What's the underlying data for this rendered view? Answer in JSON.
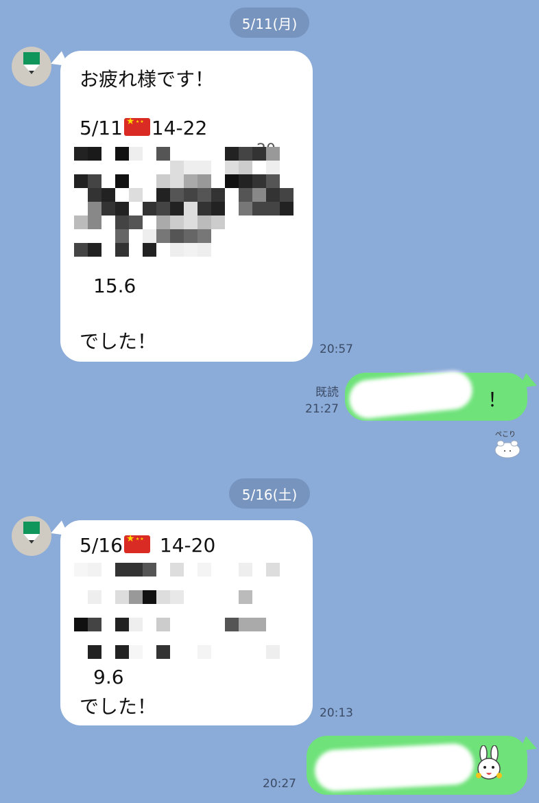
{
  "dates": [
    "5/11(月)",
    "5/16(土)"
  ],
  "messages": {
    "m1": {
      "greeting": "お疲れ様です！",
      "date": "5/11",
      "hours": "14-22",
      "partial_hidden": "20",
      "value": "15.6",
      "closing": "でした！",
      "time": "20:57"
    },
    "reply1": {
      "read_label": "既読",
      "time": "21:27",
      "visible_tail": "！"
    },
    "sticker1": {
      "caption": "ぺこり",
      "icon": "bowing-bunny-sticker"
    },
    "m2": {
      "date": "5/16",
      "hours": "14-20",
      "value": "9.6",
      "closing": "でした！",
      "time": "20:13"
    },
    "reply2": {
      "time": "20:27",
      "icon": "cony-rabbit-emoji"
    }
  },
  "colors": {
    "background": "#8babd8",
    "incoming_bubble": "#ffffff",
    "outgoing_bubble": "#6fe27a",
    "date_pill": "#7794bf"
  }
}
